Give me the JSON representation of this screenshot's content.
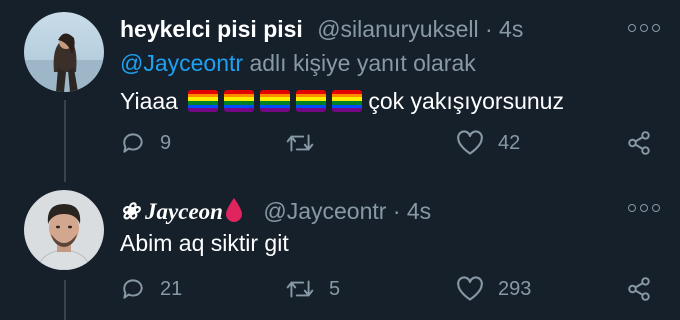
{
  "tweet1": {
    "display_name": "heykelci pisi pisi",
    "handle": "@silanuryuksell",
    "time": "· 4s",
    "reply_prefix": "@Jayceontr",
    "reply_suffix": "adlı kişiye yanıt olarak",
    "text_before": "Yiaaa",
    "flag_count": 5,
    "text_after": "çok yakışıyorsunuz",
    "replies": "9",
    "retweets": "",
    "likes": "42"
  },
  "tweet2": {
    "display_name": "❀ Jayceon",
    "handle": "@Jayceontr",
    "time": "· 4s",
    "text": "Abim aq siktir git",
    "replies": "21",
    "retweets": "5",
    "likes": "293"
  },
  "colors": {
    "background": "#15202b",
    "muted": "#8899a6",
    "link": "#1da1f2",
    "thread_line": "#38444d",
    "drop": "#e0245e"
  },
  "flag_colors": [
    "#e40303",
    "#ff8c00",
    "#ffed00",
    "#008026",
    "#004dff",
    "#750787"
  ]
}
